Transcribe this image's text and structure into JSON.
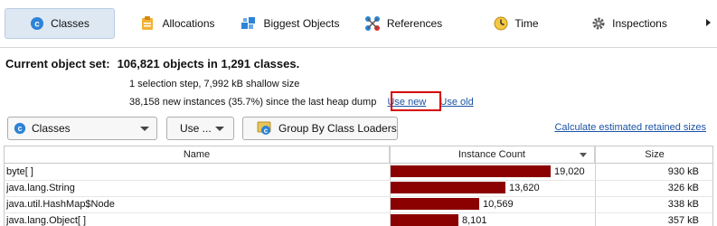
{
  "tabs": [
    {
      "label": "Classes",
      "icon": "classes-icon",
      "active": true
    },
    {
      "label": "Allocations",
      "icon": "allocations-icon",
      "active": false
    },
    {
      "label": "Biggest Objects",
      "icon": "biggest-objects-icon",
      "active": false
    },
    {
      "label": "References",
      "icon": "references-icon",
      "active": false
    },
    {
      "label": "Time",
      "icon": "time-icon",
      "active": false
    },
    {
      "label": "Inspections",
      "icon": "inspections-icon",
      "active": false
    }
  ],
  "header": {
    "title_label": "Current object set:",
    "title_value": "106,821 objects in 1,291 classes.",
    "selection_info": "1 selection step, 7,992 kB shallow size",
    "new_instances": "38,158 new instances (35.7%) since the last heap dump",
    "use_new": "Use new",
    "use_old": "Use old"
  },
  "toolbar": {
    "view_select": "Classes",
    "use_menu": "Use ...",
    "group_button": "Group By Class Loaders",
    "retained_link": "Calculate estimated retained sizes"
  },
  "table": {
    "columns": [
      "Name",
      "Instance Count",
      "Size"
    ],
    "max_count": 19020,
    "rows": [
      {
        "name": "byte[ ]",
        "count": 19020,
        "count_label": "19,020",
        "size": "930 kB"
      },
      {
        "name": "java.lang.String",
        "count": 13620,
        "count_label": "13,620",
        "size": "326 kB"
      },
      {
        "name": "java.util.HashMap$Node",
        "count": 10569,
        "count_label": "10,569",
        "size": "338 kB"
      },
      {
        "name": "java.lang.Object[ ]",
        "count": 8101,
        "count_label": "8,101",
        "size": "357 kB"
      }
    ]
  },
  "colors": {
    "bar": "#8b0000",
    "link": "#1b53a3",
    "highlight": "#d60000",
    "active_tab": "#dde8f3"
  }
}
